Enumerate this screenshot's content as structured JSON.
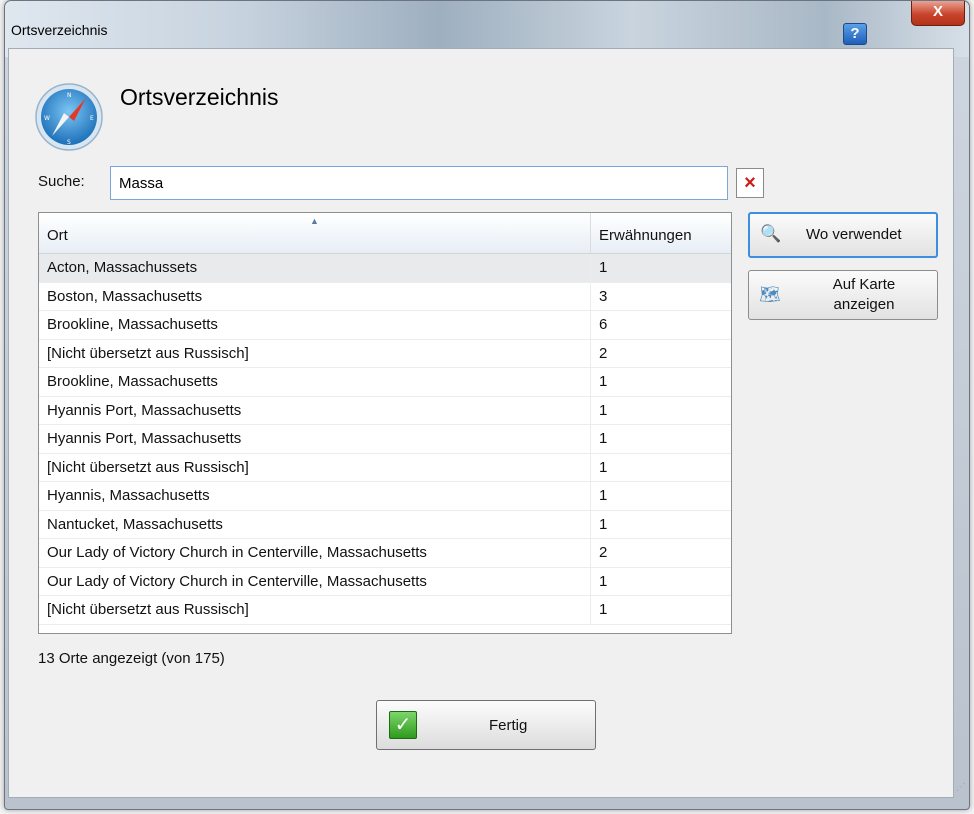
{
  "window": {
    "title": "Ortsverzeichnis",
    "help_label": "?",
    "close_label": "X"
  },
  "header": {
    "title": "Ortsverzeichnis",
    "icon": "compass-icon"
  },
  "search": {
    "label": "Suche:",
    "value": "Massa",
    "clear_label": "×"
  },
  "table": {
    "columns": [
      "Ort",
      "Erwähnungen"
    ],
    "sort_indicator": "▲",
    "rows": [
      {
        "place": "Acton, Massachussets",
        "mentions": "1"
      },
      {
        "place": "Boston, Massachusetts",
        "mentions": "3"
      },
      {
        "place": "Brookline, Massachusetts",
        "mentions": "6"
      },
      {
        "place": "[Nicht übersetzt aus Russisch]",
        "mentions": "2"
      },
      {
        "place": "Brookline, Massachusetts",
        "mentions": "1"
      },
      {
        "place": "Hyannis Port, Massachusetts",
        "mentions": "1"
      },
      {
        "place": "Hyannis Port, Massachusetts",
        "mentions": "1"
      },
      {
        "place": "[Nicht übersetzt aus Russisch]",
        "mentions": "1"
      },
      {
        "place": "Hyannis, Massachusetts",
        "mentions": "1"
      },
      {
        "place": "Nantucket, Massachusetts",
        "mentions": "1"
      },
      {
        "place": "Our Lady of Victory Church in Centerville, Massachusetts",
        "mentions": "2"
      },
      {
        "place": "Our Lady of Victory Church in Centerville, Massachusetts",
        "mentions": "1"
      },
      {
        "place": "[Nicht übersetzt aus Russisch]",
        "mentions": "1"
      }
    ]
  },
  "actions": {
    "where_used_label": "Wo verwendet",
    "where_used_icon": "magnifier-globe-icon",
    "show_map_label_1": "Auf Karte",
    "show_map_label_2": "anzeigen",
    "show_map_icon": "world-map-icon"
  },
  "status": {
    "text": "13 Orte angezeigt (von 175)"
  },
  "footer": {
    "done_label": "Fertig",
    "done_icon": "checkmark-icon"
  },
  "colors": {
    "accent": "#3d8ee0",
    "clear": "#d01818",
    "check": "#2d9a1e"
  }
}
